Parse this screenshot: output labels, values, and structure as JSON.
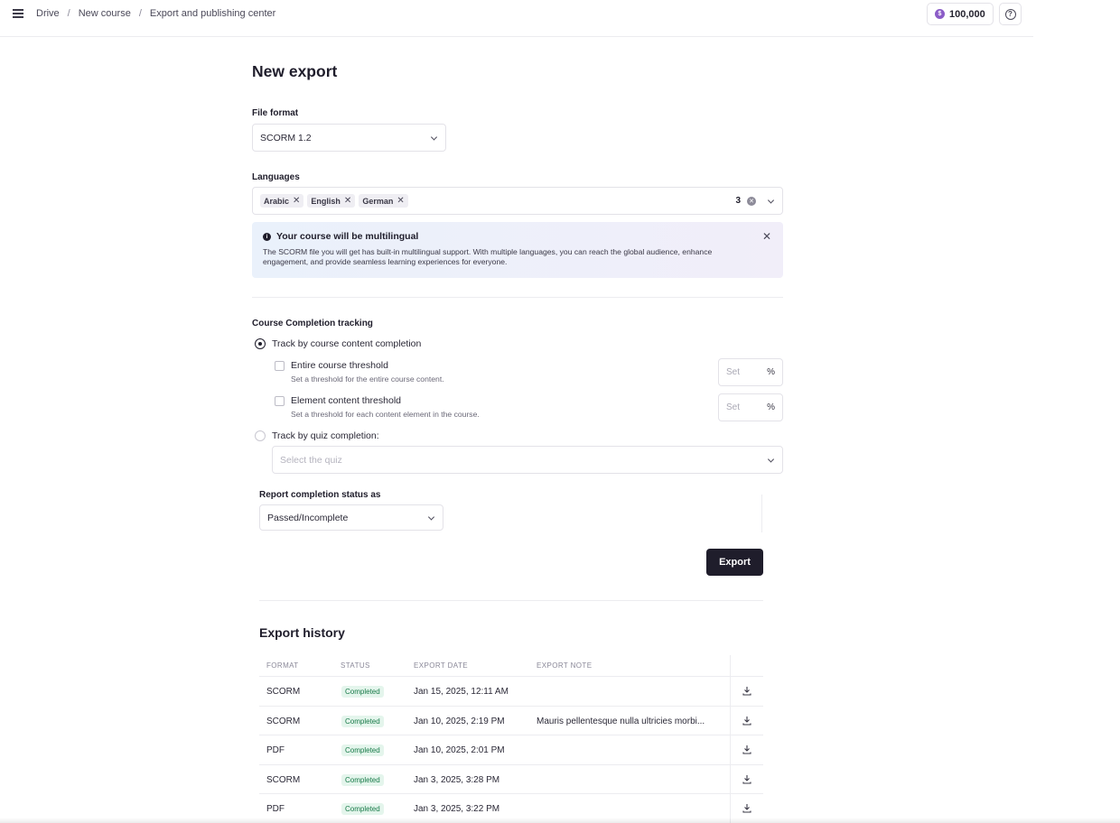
{
  "topbar": {
    "breadcrumb": [
      "Drive",
      "New course",
      "Export and publishing center"
    ],
    "credits": "100,000",
    "credit_symbol": "$"
  },
  "page_title": "New export",
  "file_format": {
    "label": "File format",
    "value": "SCORM 1.2"
  },
  "languages": {
    "label": "Languages",
    "tags": [
      "Arabic",
      "English",
      "German"
    ],
    "count": "3"
  },
  "banner": {
    "title": "Your course will be multilingual",
    "text": "The SCORM file you will get has built-in multilingual support. With multiple languages, you can reach the global audience, enhance engagement, and provide seamless learning experiences for everyone."
  },
  "tracking": {
    "label": "Course Completion tracking",
    "option_content": "Track by course content completion",
    "option_quiz": "Track by quiz completion:",
    "entire_threshold": {
      "title": "Entire course threshold",
      "hint": "Set a threshold for the entire course content.",
      "placeholder": "Set",
      "unit": "%"
    },
    "element_threshold": {
      "title": "Element content threshold",
      "hint": "Set a threshold for each content element in the course.",
      "placeholder": "Set",
      "unit": "%"
    },
    "quiz_placeholder": "Select the quiz"
  },
  "report": {
    "label": "Report completion status as",
    "value": "Passed/Incomplete"
  },
  "export_button": "Export",
  "history": {
    "title": "Export history",
    "columns": [
      "FORMAT",
      "STATUS",
      "EXPORT DATE",
      "EXPORT NOTE"
    ],
    "rows": [
      {
        "format": "SCORM",
        "status": "Completed",
        "date": "Jan 15, 2025, 12:11 AM",
        "note": ""
      },
      {
        "format": "SCORM",
        "status": "Completed",
        "date": "Jan 10, 2025, 2:19 PM",
        "note": "Mauris pellentesque nulla ultricies morbi..."
      },
      {
        "format": "PDF",
        "status": "Completed",
        "date": "Jan 10, 2025, 2:01 PM",
        "note": ""
      },
      {
        "format": "SCORM",
        "status": "Completed",
        "date": "Jan 3, 2025, 3:28 PM",
        "note": ""
      },
      {
        "format": "PDF",
        "status": "Completed",
        "date": "Jan 3, 2025, 3:22 PM",
        "note": ""
      }
    ]
  }
}
